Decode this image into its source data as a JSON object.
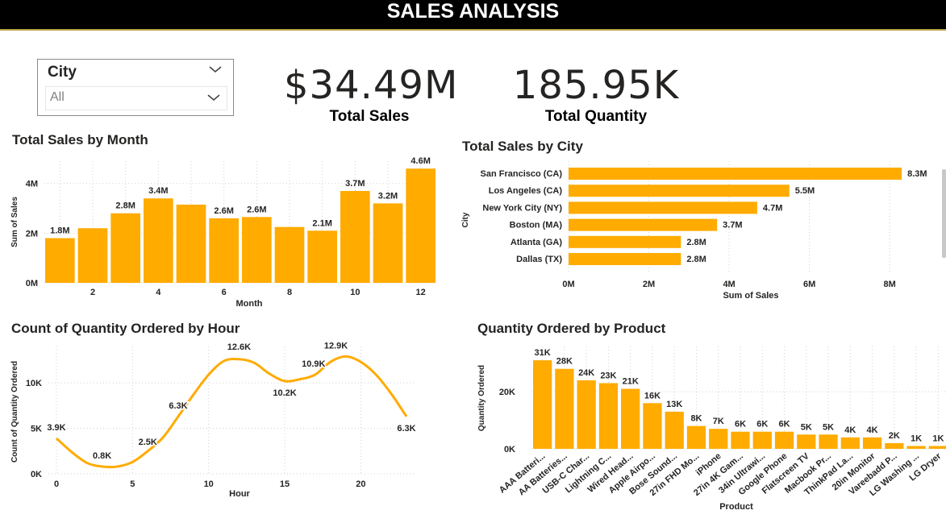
{
  "header": {
    "title": "SALES ANALYSIS"
  },
  "slicer": {
    "label": "City",
    "value": "All"
  },
  "kpis": [
    {
      "value": "$34.49M",
      "label": "Total Sales"
    },
    {
      "value": "185.95K",
      "label": "Total Quantity"
    }
  ],
  "colors": {
    "bar": "#FFAB00",
    "header_bg": "#000000",
    "accent_line": "#b9a34a"
  },
  "icons": [
    "chevron-down-icon"
  ],
  "chart_data": [
    {
      "type": "bar",
      "title": "Total Sales by Month",
      "xlabel": "Month",
      "ylabel": "Sum of Sales",
      "categories": [
        1,
        2,
        3,
        4,
        5,
        6,
        7,
        8,
        9,
        10,
        11,
        12
      ],
      "values": [
        1.8,
        2.2,
        2.8,
        3.4,
        3.15,
        2.6,
        2.65,
        2.25,
        2.1,
        3.7,
        3.2,
        4.6
      ],
      "value_unit": "M",
      "data_labels": [
        "1.8M",
        "",
        "2.8M",
        "3.4M",
        "",
        "2.6M",
        "2.6M",
        "",
        "2.1M",
        "3.7M",
        "3.2M",
        "4.6M"
      ],
      "x_ticks": [
        "2",
        "4",
        "6",
        "8",
        "10",
        "12"
      ],
      "y_ticks": [
        "0M",
        "2M",
        "4M"
      ],
      "ylim": [
        0,
        4.9
      ],
      "grid": true
    },
    {
      "type": "bar",
      "orientation": "horizontal",
      "title": "Total Sales by City",
      "xlabel": "Sum of Sales",
      "ylabel": "City",
      "categories": [
        "San Francisco (CA)",
        "Los Angeles (CA)",
        "New York City (NY)",
        "Boston (MA)",
        "Atlanta (GA)",
        "Dallas (TX)"
      ],
      "values": [
        8.3,
        5.5,
        4.7,
        3.7,
        2.8,
        2.8
      ],
      "value_unit": "M",
      "data_labels": [
        "8.3M",
        "5.5M",
        "4.7M",
        "3.7M",
        "2.8M",
        "2.8M"
      ],
      "x_ticks": [
        "0M",
        "2M",
        "4M",
        "6M",
        "8M"
      ],
      "xlim": [
        0,
        8.7
      ],
      "grid": true
    },
    {
      "type": "line",
      "title": "Count of Quantity Ordered by Hour",
      "xlabel": "Hour",
      "ylabel": "Count of Quantity Ordered",
      "x": [
        0,
        1,
        2,
        3,
        4,
        5,
        6,
        7,
        8,
        9,
        10,
        11,
        12,
        13,
        14,
        15,
        16,
        17,
        18,
        19,
        20,
        21,
        22,
        23
      ],
      "values": [
        3.9,
        2.4,
        1.2,
        0.8,
        0.8,
        1.3,
        2.5,
        4.0,
        6.3,
        8.7,
        10.9,
        12.4,
        12.6,
        12.2,
        11.0,
        10.2,
        10.4,
        10.9,
        12.3,
        12.9,
        12.3,
        10.9,
        8.8,
        6.3
      ],
      "value_unit": "K",
      "data_labels": [
        {
          "x": 0,
          "text": "3.9K"
        },
        {
          "x": 3,
          "text": "0.8K"
        },
        {
          "x": 6,
          "text": "2.5K"
        },
        {
          "x": 8,
          "text": "6.3K"
        },
        {
          "x": 12,
          "text": "12.6K"
        },
        {
          "x": 15,
          "text": "10.2K"
        },
        {
          "x": 17,
          "text": "10.9K"
        },
        {
          "x": 19,
          "text": "12.9K"
        },
        {
          "x": 23,
          "text": "6.3K"
        }
      ],
      "x_ticks": [
        "0",
        "5",
        "10",
        "15",
        "20"
      ],
      "y_ticks": [
        "0K",
        "5K",
        "10K"
      ],
      "ylim": [
        0,
        14
      ],
      "grid": true
    },
    {
      "type": "bar",
      "title": "Quantity Ordered by Product",
      "xlabel": "Product",
      "ylabel": "Quantity Ordered",
      "categories": [
        "AAA Batteri...",
        "AA Batteries...",
        "USB-C Char...",
        "Lightning C...",
        "Wired Head...",
        "Apple Airpo...",
        "Bose Sound...",
        "27in FHD Mo...",
        "iPhone",
        "27in 4K Gam...",
        "34in Ultrawi...",
        "Google Phone",
        "Flatscreen TV",
        "Macbook Pr...",
        "ThinkPad La...",
        "20in Monitor",
        "Vareebadd P...",
        "LG Washing ...",
        "LG Dryer"
      ],
      "values": [
        31,
        28,
        24,
        23,
        21,
        16,
        13,
        8,
        7,
        6,
        6,
        6,
        5,
        5,
        4,
        4,
        2,
        1,
        1
      ],
      "value_unit": "K",
      "data_labels": [
        "31K",
        "28K",
        "24K",
        "23K",
        "21K",
        "16K",
        "13K",
        "8K",
        "7K",
        "6K",
        "6K",
        "6K",
        "5K",
        "5K",
        "4K",
        "4K",
        "2K",
        "1K",
        "1K"
      ],
      "y_ticks": [
        "0K",
        "20K"
      ],
      "ylim": [
        0,
        33
      ],
      "grid": true
    }
  ]
}
